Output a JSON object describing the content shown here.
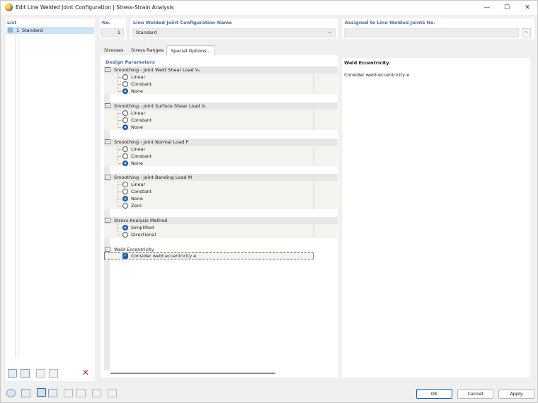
{
  "window": {
    "title": "Edit Line Welded Joint Configuration | Stress-Strain Analysis"
  },
  "list": {
    "header": "List",
    "items": [
      {
        "no": "1",
        "name": "Standard"
      }
    ]
  },
  "header": {
    "no_label": "No.",
    "no_value": "1",
    "name_label": "Line Welded Joint Configuration Name",
    "name_value": "Standard",
    "assigned_label": "Assigned to Line Welded Joints No.",
    "assigned_value": ""
  },
  "tabs": [
    {
      "label": "Stresses"
    },
    {
      "label": "Stress Ranges"
    },
    {
      "label": "Special Options..."
    }
  ],
  "design": {
    "section_title": "Design Parameters",
    "groups": [
      {
        "title": "Smoothing - Joint Weld Shear Load Vᵥ",
        "options": [
          "Linear",
          "Constant",
          "None"
        ],
        "selected": "None"
      },
      {
        "title": "Smoothing - Joint Surface Shear Load Vₛ",
        "options": [
          "Linear",
          "Constant",
          "None"
        ],
        "selected": "None"
      },
      {
        "title": "Smoothing - Joint Normal Load P",
        "options": [
          "Linear",
          "Constant",
          "None"
        ],
        "selected": "None"
      },
      {
        "title": "Smoothing - Joint Bending Load M",
        "options": [
          "Linear",
          "Constant",
          "None",
          "Zero"
        ],
        "selected": "None"
      },
      {
        "title": "Stress Analysis Method",
        "options": [
          "Simplified",
          "Directional"
        ],
        "selected": "Simplified"
      },
      {
        "title": "Weld Eccentricity",
        "checkbox_label": "Consider weld eccentricity e",
        "checked": true
      }
    ]
  },
  "info": {
    "title": "Weld Eccentricity",
    "text": "Consider weld eccentricity e"
  },
  "footer": {
    "ok": "OK",
    "cancel": "Cancel",
    "apply": "Apply"
  },
  "colors": {
    "accent": "#1a5fb4",
    "header_label": "#4a6fa5",
    "delete": "#d32f2f"
  }
}
